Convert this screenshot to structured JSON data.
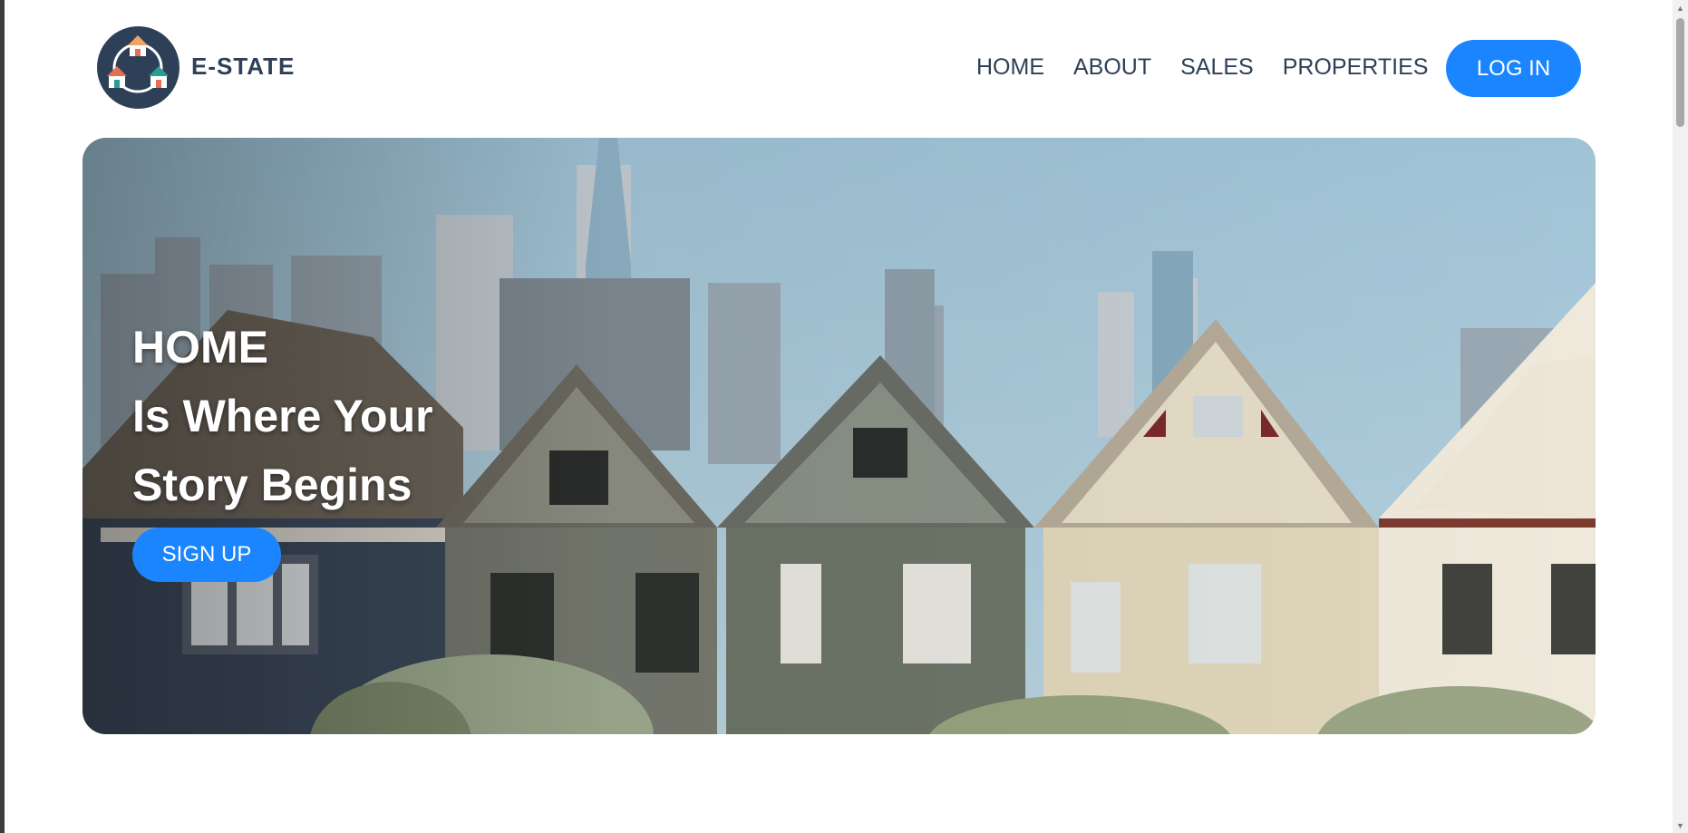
{
  "header": {
    "brand": "E-STATE",
    "logo_icon": "houses-network-logo",
    "menu": [
      {
        "label": "HOME"
      },
      {
        "label": "ABOUT"
      },
      {
        "label": "SALES"
      },
      {
        "label": "PROPERTIES"
      }
    ],
    "login_label": "LOG IN"
  },
  "hero": {
    "image": "victorian-houses-city-skyline",
    "line1": "HOME",
    "line2": "Is Where Your",
    "line3": "Story Begins",
    "signup_label": "SIGN UP"
  },
  "colors": {
    "accent": "#1a85ff",
    "brand": "#2e4057"
  }
}
